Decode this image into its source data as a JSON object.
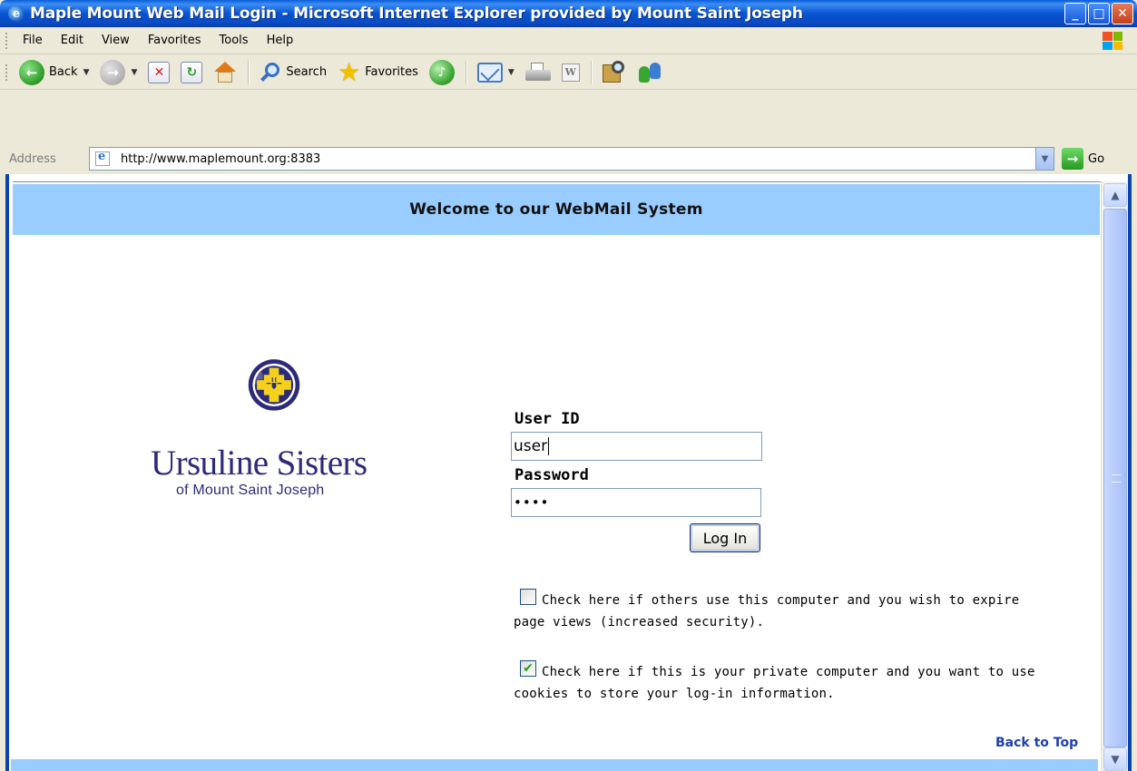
{
  "window": {
    "title": "Maple Mount Web Mail Login - Microsoft Internet Explorer provided by Mount Saint Joseph",
    "controls": {
      "minimize": "_",
      "maximize": "□",
      "close": "✕"
    }
  },
  "menu": {
    "items": [
      "File",
      "Edit",
      "View",
      "Favorites",
      "Tools",
      "Help"
    ]
  },
  "toolbar": {
    "back_label": "Back",
    "search_label": "Search",
    "favorites_label": "Favorites"
  },
  "address": {
    "label": "Address",
    "url": "http://www.maplemount.org:8383",
    "go_label": "Go"
  },
  "page": {
    "welcome": "Welcome to our WebMail System",
    "logo": {
      "name": "Ursuline Sisters",
      "sub": "of Mount Saint Joseph"
    },
    "form": {
      "user_id_label": "User ID",
      "user_id_value": "user",
      "password_label": "Password",
      "password_value": "••••",
      "login_button": "Log In"
    },
    "options": [
      {
        "checked": false,
        "line1": "Check here if others use this computer and you wish to expire",
        "line2": "page views (increased security)."
      },
      {
        "checked": true,
        "line1": "Check here if this is your private computer and you want to use",
        "line2": "cookies to store your log-in information."
      }
    ],
    "back_to_top": "Back to Top"
  },
  "colors": {
    "title_bar": "#0a5fd8",
    "banner": "#99ccff",
    "logo_navy": "#2d2a7a",
    "logo_gold": "#f4d21b",
    "link": "#1f3fae"
  },
  "icons": {
    "toolbar": [
      "back-icon",
      "forward-icon",
      "stop-icon",
      "refresh-icon",
      "home-icon",
      "search-icon",
      "favorites-star-icon",
      "media-icon",
      "mail-icon",
      "print-icon",
      "edit-icon",
      "research-icon",
      "messenger-icon"
    ]
  }
}
